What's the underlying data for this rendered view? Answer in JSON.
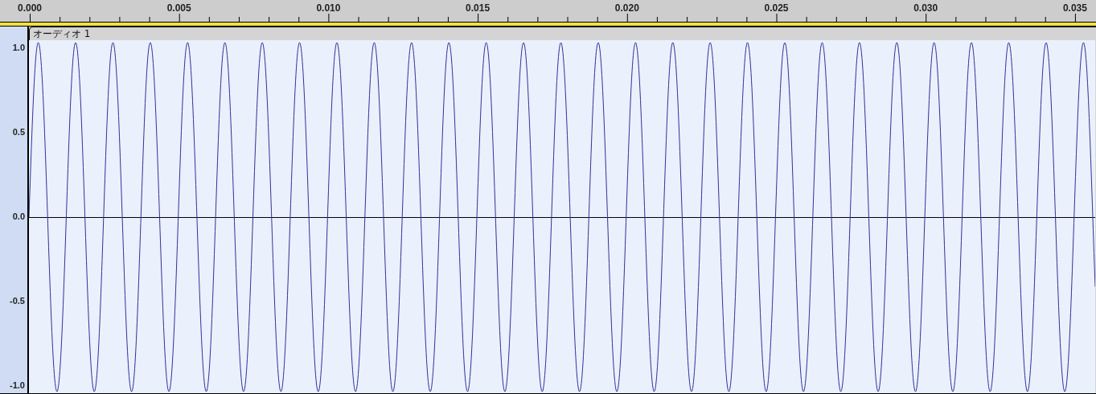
{
  "ruler": {
    "ticks": [
      "0.000",
      "0.005",
      "0.010",
      "0.015",
      "0.020",
      "0.025",
      "0.030",
      "0.035"
    ]
  },
  "track": {
    "name": "オーディオ 1",
    "scale": [
      "1.0",
      "0.5",
      "0.0",
      "-0.5",
      "-1.0"
    ]
  }
}
